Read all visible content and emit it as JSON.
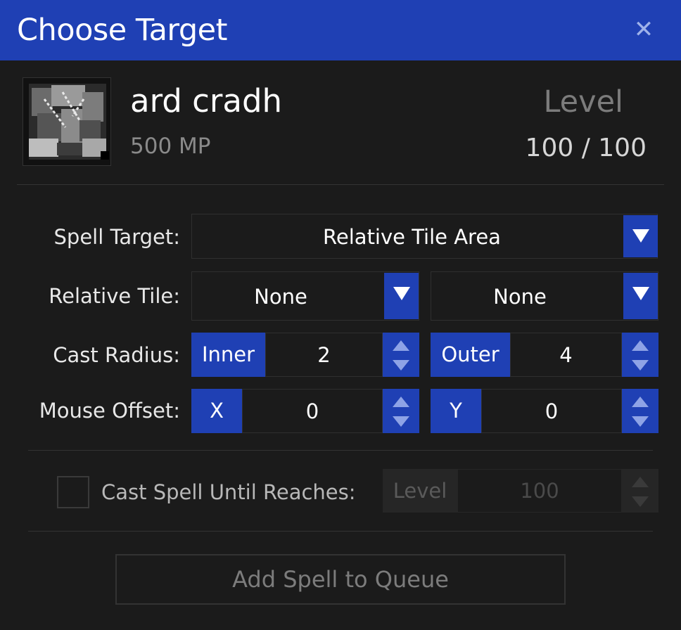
{
  "window": {
    "title": "Choose Target",
    "close_glyph": "✕"
  },
  "spell": {
    "name": "ard cradh",
    "cost": "500 MP",
    "icon": "spell-icon"
  },
  "level": {
    "label": "Level",
    "value": "100 / 100"
  },
  "spell_target": {
    "label": "Spell Target:",
    "selected": "Relative Tile Area"
  },
  "relative_tile": {
    "label": "Relative Tile:",
    "first": "None",
    "second": "None"
  },
  "cast_radius": {
    "label": "Cast Radius:",
    "inner_label": "Inner",
    "inner_value": "2",
    "outer_label": "Outer",
    "outer_value": "4"
  },
  "mouse_offset": {
    "label": "Mouse Offset:",
    "x_label": "X",
    "x_value": "0",
    "y_label": "Y",
    "y_value": "0"
  },
  "cast_until": {
    "label": "Cast Spell Until Reaches:",
    "checked": false,
    "unit_label": "Level",
    "value": "100"
  },
  "queue_button": {
    "label": "Add Spell to Queue"
  },
  "colors": {
    "accent": "#1f40b4",
    "background": "#1b1b1b"
  }
}
